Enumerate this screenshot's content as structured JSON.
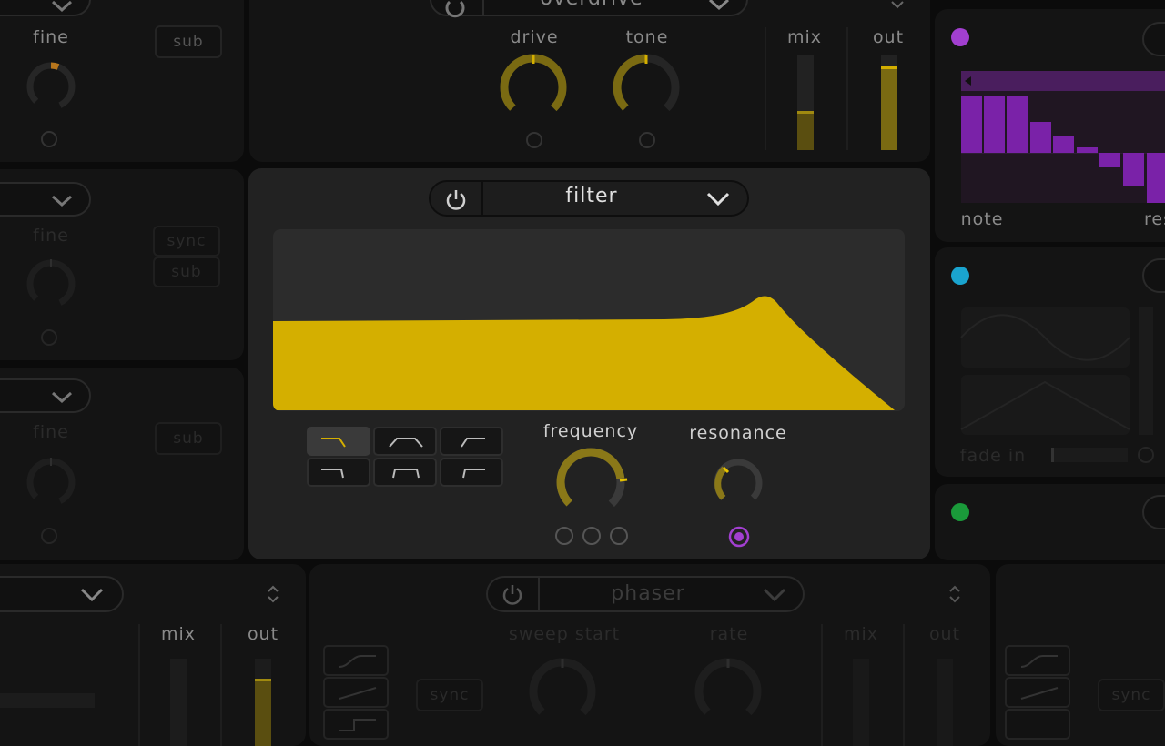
{
  "colors": {
    "accent": "#d4af00",
    "accent_dim": "#7a6a12",
    "purple": "#a23fd0",
    "cyan": "#1aa4cf",
    "green": "#1a9a3a",
    "orange": "#b8761c"
  },
  "osc_left": {
    "fine_label": "fine",
    "sub_label": "sub",
    "sync_label": "sync"
  },
  "distortion": {
    "preset": "overdrive",
    "drive_label": "drive",
    "tone_label": "tone",
    "mix_label": "mix",
    "out_label": "out"
  },
  "filter": {
    "title": "filter",
    "frequency_label": "frequency",
    "resonance_label": "resonance",
    "types": [
      "low-pass-12",
      "band-pass-12",
      "high-pass-12",
      "low-pass-24",
      "band-pass-24",
      "high-pass-24"
    ],
    "active_type": "low-pass-12",
    "frequency_value": 0.7,
    "resonance_value": 0.35
  },
  "sequencer": {
    "note_label": "note",
    "reset_label": "reset",
    "step_values": [
      0.85,
      0.85,
      0.85,
      0.45,
      0.25,
      0.1,
      -0.25,
      -0.5,
      -0.8
    ]
  },
  "lfo": {
    "fade_label": "fade in"
  },
  "bottom_left": {
    "mix_label": "mix",
    "out_label": "out"
  },
  "phaser": {
    "title": "phaser",
    "sweep_label": "sweep start",
    "rate_label": "rate",
    "mix_label": "mix",
    "out_label": "out",
    "sync_label": "sync"
  }
}
